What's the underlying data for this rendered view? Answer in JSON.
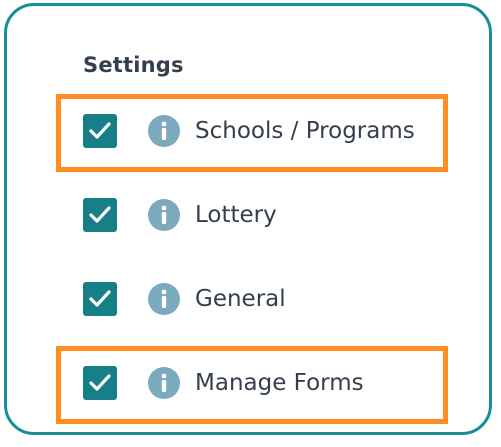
{
  "settings": {
    "title": "Settings",
    "items": [
      {
        "label": "Schools / Programs",
        "checked": true,
        "highlighted": true
      },
      {
        "label": "Lottery",
        "checked": true,
        "highlighted": false
      },
      {
        "label": "General",
        "checked": true,
        "highlighted": false
      },
      {
        "label": "Manage Forms",
        "checked": true,
        "highlighted": true
      }
    ]
  },
  "colors": {
    "frame_border": "#178f95",
    "checkbox_fill": "#177f87",
    "info_icon": "#7ba9bd",
    "text": "#34404e",
    "highlight": "#ff8d24"
  },
  "icons": {
    "checkbox": "check-icon",
    "info": "info-icon"
  }
}
